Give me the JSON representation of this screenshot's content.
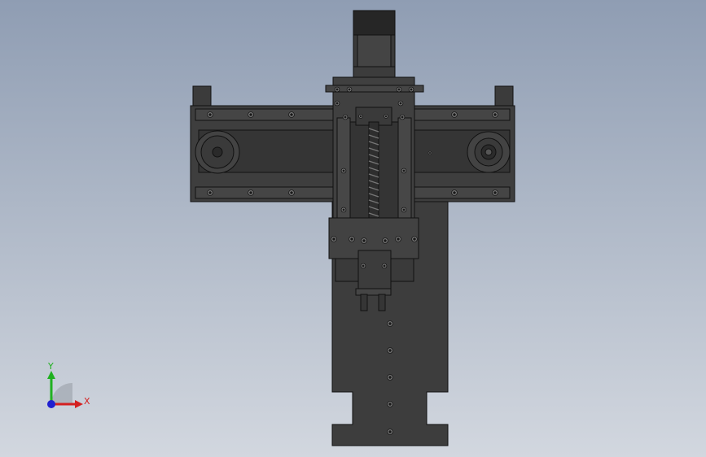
{
  "triad": {
    "x_label": "X",
    "y_label": "Y",
    "x_color": "#d42020",
    "y_color": "#20b020",
    "z_color": "#2020d0"
  },
  "model": {
    "body_color": "#3b3b3b",
    "edge_color": "#111111",
    "slot_color": "#2a2a2a",
    "screw_color": "#7a7a7a"
  }
}
